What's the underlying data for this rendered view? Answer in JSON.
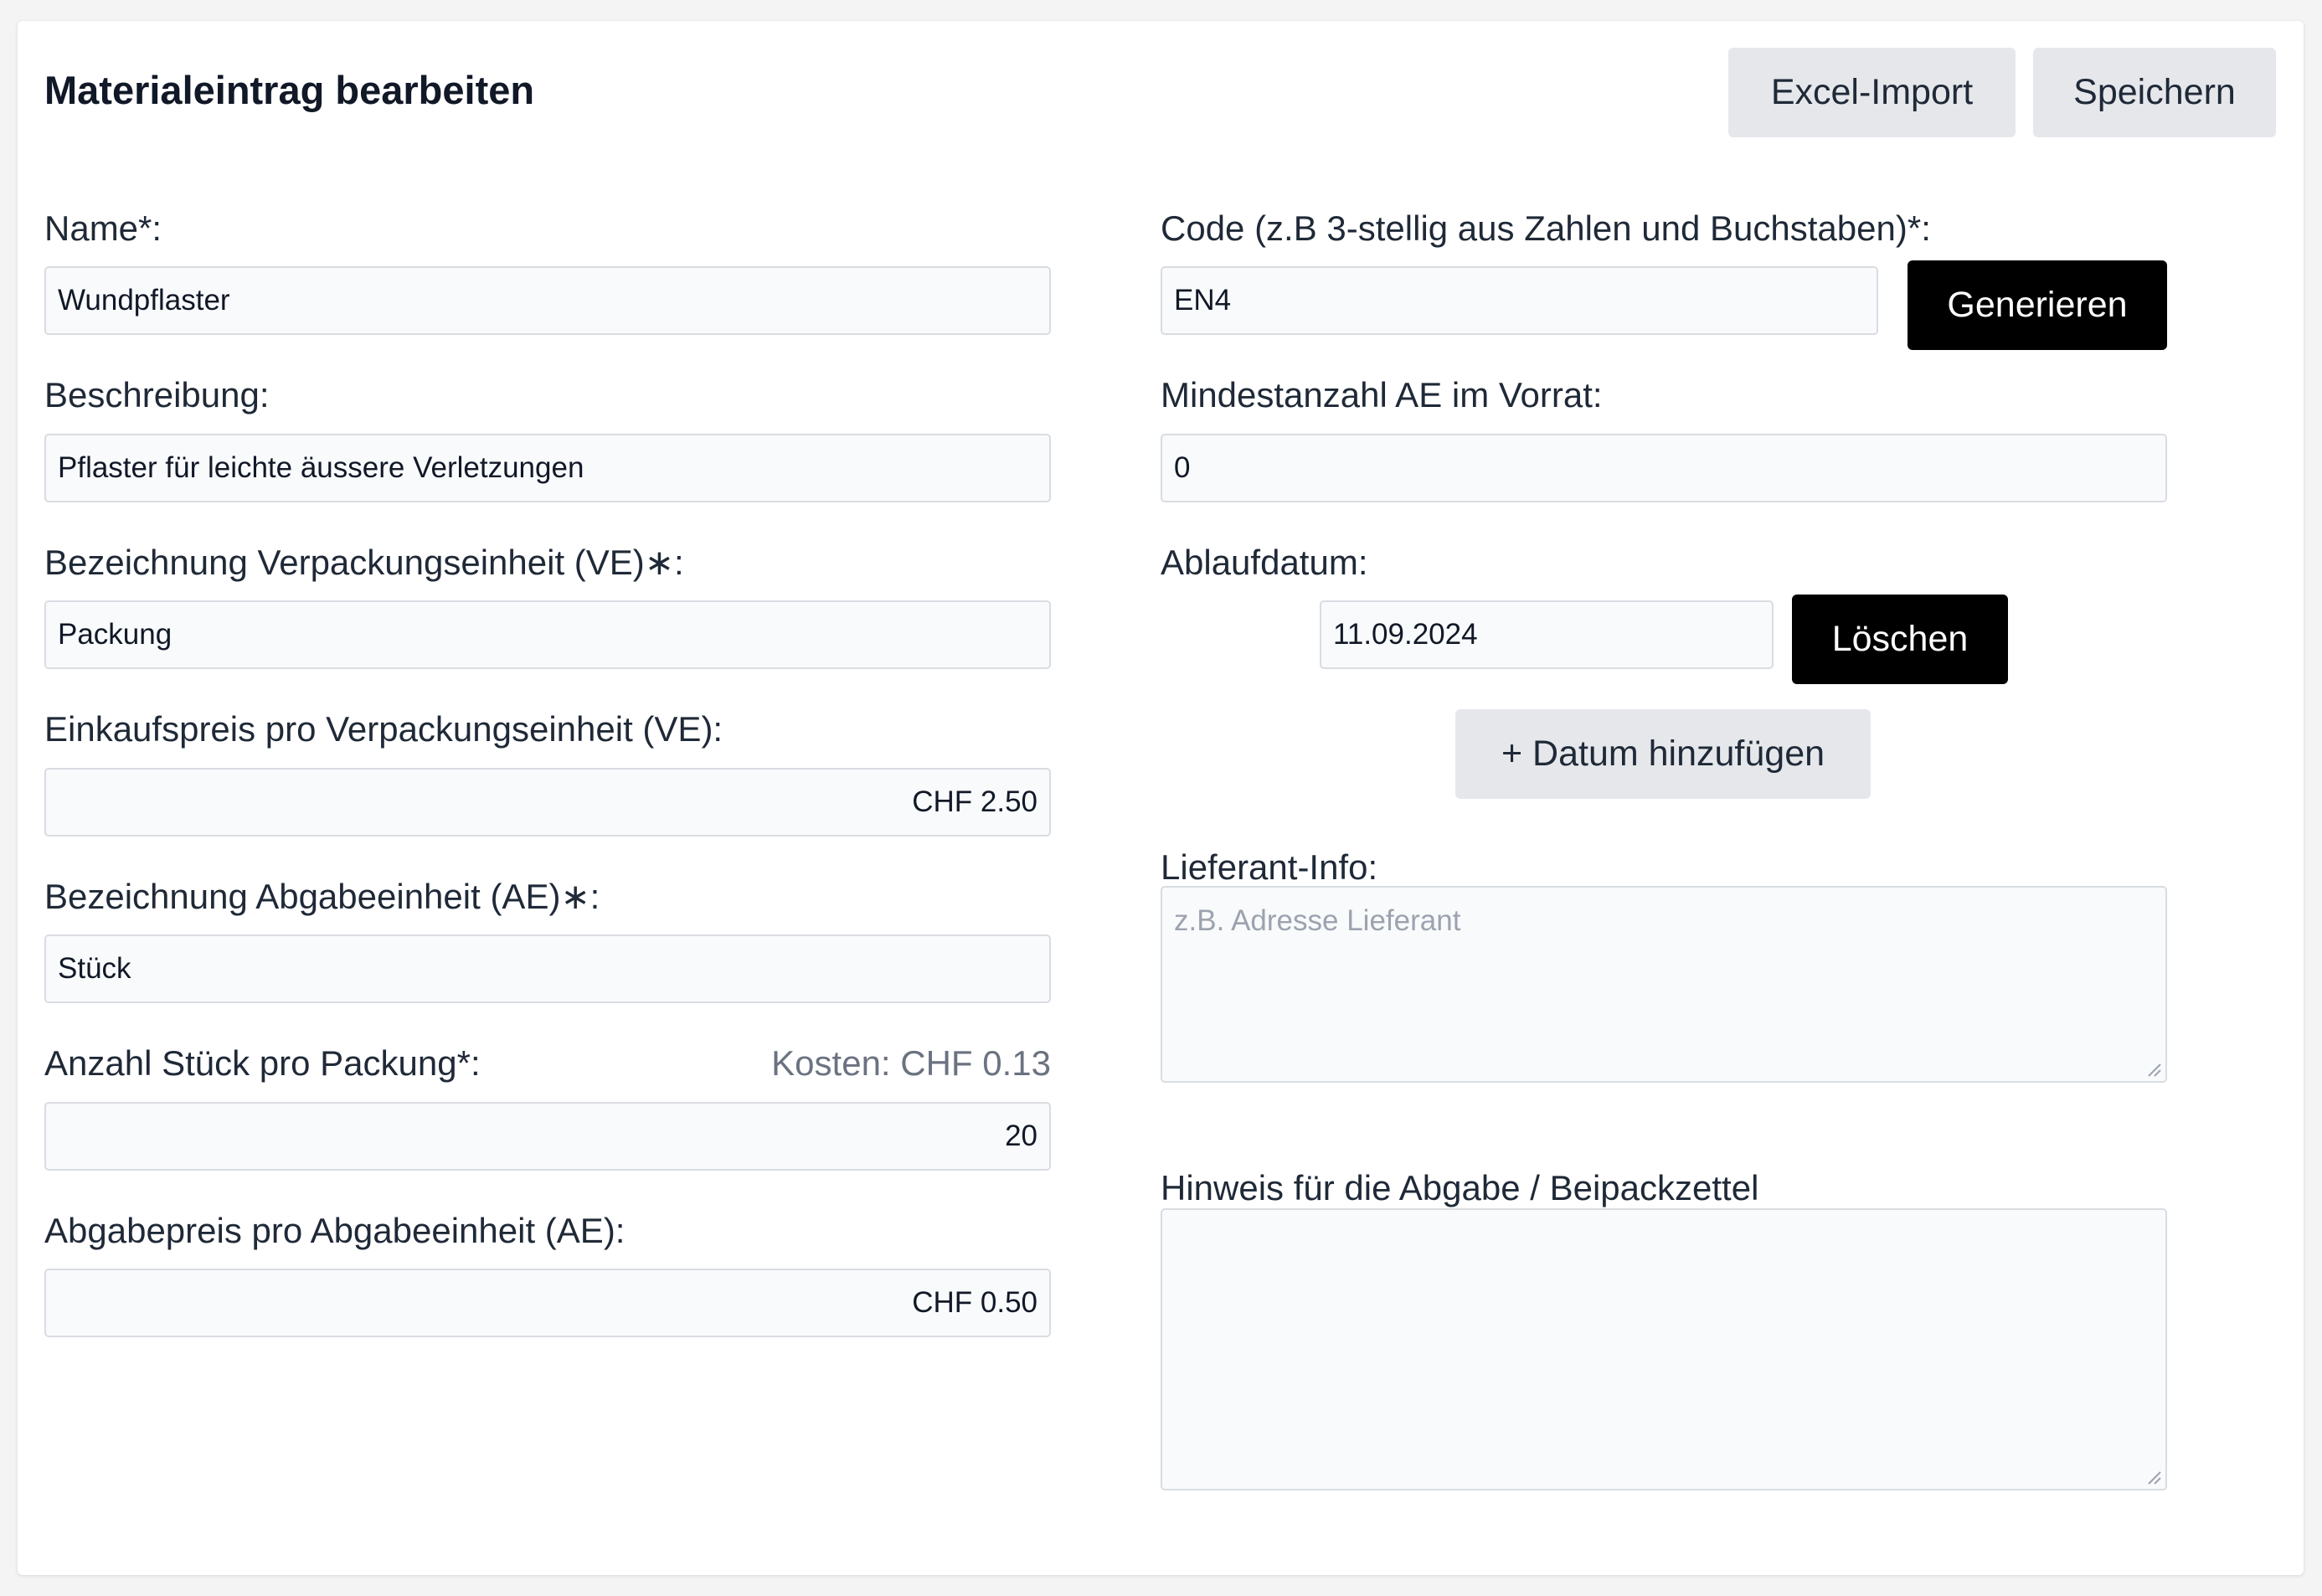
{
  "header": {
    "title": "Materialeintrag bearbeiten",
    "excel_import_label": "Excel-Import",
    "save_label": "Speichern"
  },
  "left": {
    "name_label": "Name*:",
    "name_value": "Wundpflaster",
    "description_label": "Beschreibung:",
    "description_value": "Pflaster für leichte äussere Verletzungen",
    "package_unit_label": "Bezeichnung Verpackungseinheit (VE)∗:",
    "package_unit_value": "Packung",
    "purchase_price_label": "Einkaufspreis pro Verpackungseinheit (VE):",
    "purchase_price_value": "CHF 2.50",
    "dispense_unit_label": "Bezeichnung Abgabeeinheit (AE)∗:",
    "dispense_unit_value": "Stück",
    "pieces_per_package_label": "Anzahl Stück pro Packung*:",
    "cost_hint": "Kosten: CHF 0.13",
    "pieces_per_package_value": "20",
    "dispense_price_label": "Abgabepreis pro Abgabeeinheit (AE):",
    "dispense_price_value": "CHF 0.50"
  },
  "right": {
    "code_label": "Code (z.B 3-stellig aus Zahlen und Buchstaben)*:",
    "code_value": "EN4",
    "generate_label": "Generieren",
    "min_stock_label": "Mindestanzahl AE im Vorrat:",
    "min_stock_value": "0",
    "expiry_label": "Ablaufdatum:",
    "expiry_value": "11.09.2024",
    "delete_label": "Löschen",
    "add_date_label": "+ Datum hinzufügen",
    "supplier_label": "Lieferant-Info:",
    "supplier_placeholder": "z.B. Adresse Lieferant",
    "supplier_value": "",
    "notes_label": "Hinweis für die Abgabe / Beipackzettel",
    "notes_value": ""
  }
}
